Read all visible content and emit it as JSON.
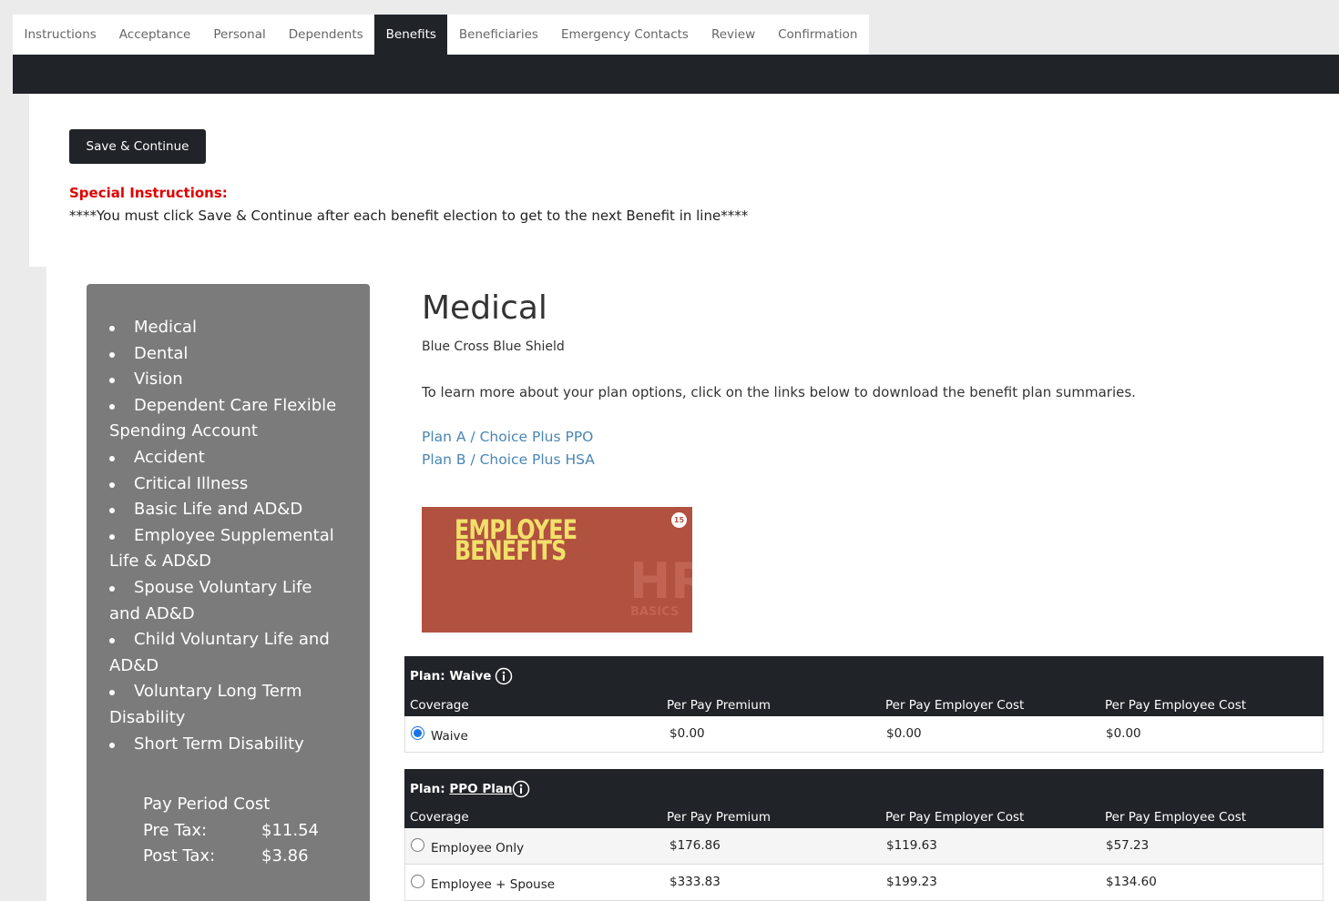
{
  "tabs": [
    "Instructions",
    "Acceptance",
    "Personal",
    "Dependents",
    "Benefits",
    "Beneficiaries",
    "Emergency Contacts",
    "Review",
    "Confirmation"
  ],
  "active_tab": "Benefits",
  "save_button": "Save & Continue",
  "special_instructions": {
    "title": "Special Instructions:",
    "text": "****You must click Save & Continue after each benefit election to get to the next Benefit in line****"
  },
  "sidebar": {
    "items": [
      "Medical",
      "Dental",
      "Vision",
      "Dependent Care Flexible Spending Account",
      "Accident",
      "Critical Illness",
      "Basic Life and AD&D",
      "Employee Supplemental Life & AD&D",
      "Spouse Voluntary Life and AD&D",
      "Child Voluntary Life and AD&D",
      "Voluntary Long Term Disability",
      "Short Term Disability"
    ],
    "cost": {
      "title": "Pay Period Cost",
      "pre_tax_label": "Pre Tax:",
      "pre_tax": "$11.54",
      "post_tax_label": "Post Tax:",
      "post_tax": "$3.86"
    }
  },
  "benefit": {
    "title": "Medical",
    "carrier": "Blue Cross Blue Shield",
    "learn_more": "To learn more about your plan options, click on the links below to download the benefit plan summaries.",
    "links": [
      "Plan A / Choice Plus PPO",
      "Plan B / Choice Plus HSA"
    ],
    "banner": {
      "line1": "EMPLOYEE",
      "line2": "BENEFITS",
      "mark": "HR",
      "mark_sub": "BASICS",
      "badge": "15"
    }
  },
  "columns": [
    "Coverage",
    "Per Pay Premium",
    "Per Pay Employer Cost",
    "Per Pay Employee Cost"
  ],
  "plans": [
    {
      "label": "Plan:",
      "name": "Waive",
      "rows": [
        {
          "coverage": "Waive",
          "premium": "$0.00",
          "employer": "$0.00",
          "employee": "$0.00",
          "selected": true
        }
      ]
    },
    {
      "label": "Plan:",
      "name": "PPO Plan",
      "rows": [
        {
          "coverage": "Employee Only",
          "premium": "$176.86",
          "employer": "$119.63",
          "employee": "$57.23",
          "selected": false
        },
        {
          "coverage": "Employee + Spouse",
          "premium": "$333.83",
          "employer": "$199.23",
          "employee": "$134.60",
          "selected": false
        }
      ]
    }
  ]
}
